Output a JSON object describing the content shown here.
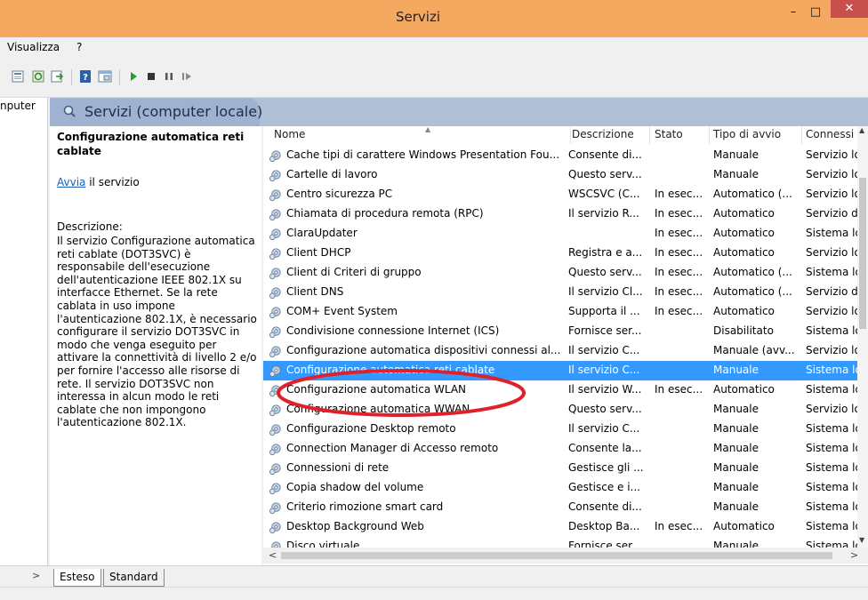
{
  "window": {
    "title": "Servizi",
    "minimize_glyph": "–",
    "maximize_glyph": "□",
    "close_glyph": "✕"
  },
  "menu": [
    "Visualizza",
    "?"
  ],
  "left_pane": {
    "label": "nputer"
  },
  "header": {
    "title": "Servizi (computer locale)"
  },
  "details": {
    "service_name": "Configurazione automatica reti cablate",
    "action_link": "Avvia",
    "action_rest": " il servizio",
    "description_label": "Descrizione:",
    "description": "Il servizio Configurazione automatica reti cablate (DOT3SVC) è responsabile dell'esecuzione dell'autenticazione IEEE 802.1X su interfacce Ethernet. Se la rete cablata in uso impone l'autenticazione 802.1X, è necessario configurare il servizio DOT3SVC in modo che venga eseguito per attivare la connettività di livello 2 e/o per fornire l'accesso alle risorse di rete. Il servizio DOT3SVC non interessa in alcun modo le reti cablate che non impongono l'autenticazione 802.1X."
  },
  "table": {
    "columns": [
      "Nome",
      "Descrizione",
      "Stato",
      "Tipo di avvio",
      "Connessi"
    ],
    "rows": [
      [
        "Cache tipi di carattere Windows Presentation Fou...",
        "Consente di...",
        "",
        "Manuale",
        "Servizio lo"
      ],
      [
        "Cartelle di lavoro",
        "Questo serv...",
        "",
        "Manuale",
        "Servizio lo"
      ],
      [
        "Centro sicurezza PC",
        "WSCSVC (C...",
        "In esec...",
        "Automatico (...",
        "Servizio lo"
      ],
      [
        "Chiamata di procedura remota (RPC)",
        "Il servizio R...",
        "In esec...",
        "Automatico",
        "Servizio d"
      ],
      [
        "ClaraUpdater",
        "",
        "In esec...",
        "Automatico",
        "Sistema lo"
      ],
      [
        "Client DHCP",
        "Registra e a...",
        "In esec...",
        "Automatico",
        "Servizio lo"
      ],
      [
        "Client di Criteri di gruppo",
        "Questo serv...",
        "In esec...",
        "Automatico (...",
        "Sistema lo"
      ],
      [
        "Client DNS",
        "Il servizio Cl...",
        "In esec...",
        "Automatico (...",
        "Servizio d"
      ],
      [
        "COM+ Event System",
        "Supporta il ...",
        "In esec...",
        "Automatico",
        "Servizio lo"
      ],
      [
        "Condivisione connessione Internet (ICS)",
        "Fornisce ser...",
        "",
        "Disabilitato",
        "Sistema lo"
      ],
      [
        "Configurazione automatica dispositivi connessi al...",
        "Il servizio C...",
        "",
        "Manuale (avv...",
        "Servizio lo"
      ],
      [
        "Configurazione automatica reti cablate",
        "Il servizio C...",
        "",
        "Manuale",
        "Sistema lo"
      ],
      [
        "Configurazione automatica WLAN",
        "Il servizio W...",
        "In esec...",
        "Automatico",
        "Sistema lo"
      ],
      [
        "Configurazione automatica WWAN",
        "Questo serv...",
        "",
        "Manuale",
        "Servizio lo"
      ],
      [
        "Configurazione Desktop remoto",
        "Il servizio C...",
        "",
        "Manuale",
        "Sistema lo"
      ],
      [
        "Connection Manager di Accesso remoto",
        "Consente la...",
        "",
        "Manuale",
        "Sistema lo"
      ],
      [
        "Connessioni di rete",
        "Gestisce gli ...",
        "",
        "Manuale",
        "Sistema lo"
      ],
      [
        "Copia shadow del volume",
        "Gestisce e i...",
        "",
        "Manuale",
        "Sistema lo"
      ],
      [
        "Criterio rimozione smart card",
        "Consente di...",
        "",
        "Manuale",
        "Sistema lo"
      ],
      [
        "Desktop Background Web",
        "Desktop Ba...",
        "In esec...",
        "Automatico",
        "Sistema lo"
      ],
      [
        "Disco virtuale",
        "Fornisce ser...",
        "",
        "Manuale",
        "Sistema lo"
      ]
    ],
    "selected_row": 11
  },
  "tabs": [
    "Esteso",
    "Standard"
  ],
  "tab_scroll_glyph": ">",
  "colors": {
    "title_bar": "#f4a860",
    "selection": "#3399ff",
    "annotation": "#e0202a",
    "header_strip": "#aebfd6"
  }
}
